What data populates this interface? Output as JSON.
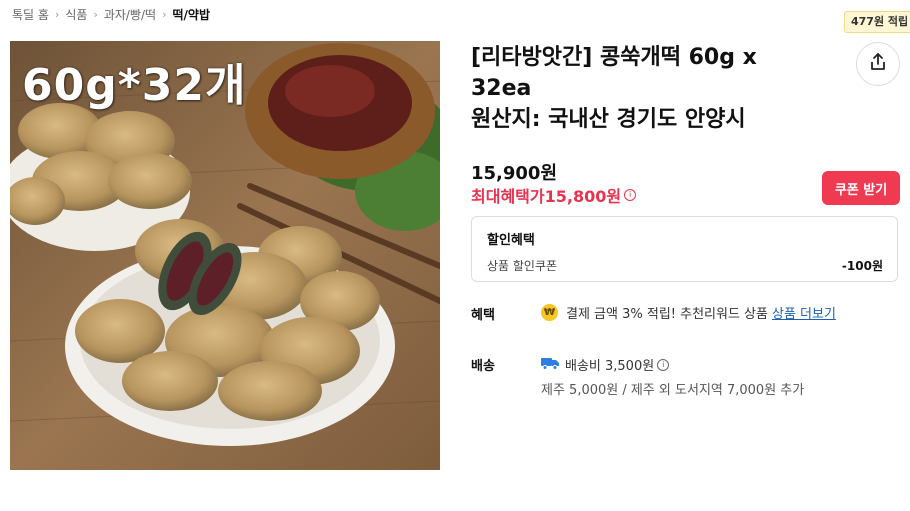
{
  "breadcrumb": {
    "items": [
      "톡딜 홈",
      "식품",
      "과자/빵/떡",
      "떡/약밥"
    ],
    "separator": "›"
  },
  "product": {
    "image_caption": "60g*32개",
    "title_lines": [
      "[리타방앗간] 콩쑥개떡 60g x",
      "32ea",
      "원산지: 국내산 경기도 안양시"
    ],
    "price": "15,900원",
    "max_benefit_label": "최대혜택가",
    "max_benefit_price": "15,800원"
  },
  "reward_badge": "477원 적립",
  "share_icon": "share-icon",
  "coupon_button": "쿠폰 받기",
  "discount": {
    "title": "할인혜택",
    "row_label": "상품 할인쿠폰",
    "row_value": "-100원"
  },
  "benefit": {
    "label": "혜택",
    "icon": "won-coin-icon",
    "icon_glyph": "₩",
    "text": "결제 금액 3% 적립! 추천리워드 상품",
    "link": "상품 더보기"
  },
  "delivery": {
    "label": "배송",
    "icon": "truck-icon",
    "fee": "배송비 3,500원",
    "note": "제주 5,000원 / 제주 외 도서지역 7,000원 추가"
  },
  "colors": {
    "accent_red": "#e8344e",
    "coupon_bg": "#ef3a52",
    "link_blue": "#1a5fb4",
    "badge_bg": "#fff6d4",
    "truck_blue": "#2f7de1"
  }
}
